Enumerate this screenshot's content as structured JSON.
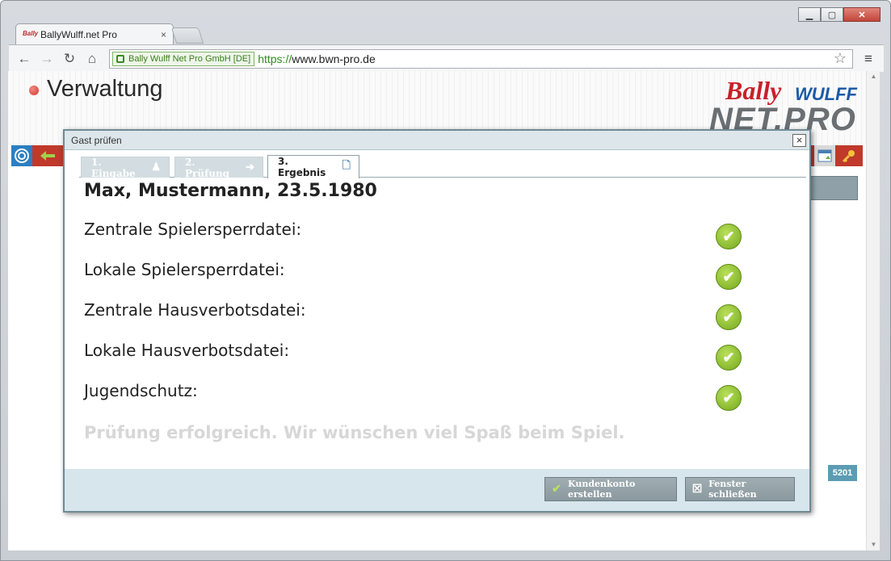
{
  "browser": {
    "tab_title": "BallyWulff.net Pro",
    "tab_close": "×",
    "ev_label": "Bally Wulff Net Pro GmbH [DE]",
    "url_scheme": "https://",
    "url_host": "www.bwn-pro.de",
    "favicon_text": "Bally",
    "controls": {
      "minimize": "▁",
      "maximize": "▢",
      "close": "✕"
    },
    "nav": {
      "back": "←",
      "forward": "→",
      "reload": "↻",
      "home": "⌂",
      "star": "☆",
      "menu": "≡"
    }
  },
  "page": {
    "title": "Verwaltung",
    "logo": {
      "bally": "Bally",
      "wulff": "WULFF",
      "netpro": "NET.PRO"
    },
    "badge": "5201"
  },
  "dialog": {
    "title": "Gast prüfen",
    "close_glyph": "×",
    "tabs": [
      {
        "label": "1. Eingabe",
        "icon": "person-icon",
        "glyph": "♟"
      },
      {
        "label": "2. Prüfung",
        "icon": "arrow-icon",
        "glyph": "➔"
      },
      {
        "label": "3. Ergebnis",
        "icon": "document-icon",
        "glyph": "🗋"
      }
    ],
    "guest_name": "Max, Mustermann, 23.5.1980",
    "checks": [
      {
        "label": "Zentrale Spielersperrdatei:",
        "status": "ok"
      },
      {
        "label": "Lokale Spielersperrdatei:",
        "status": "ok"
      },
      {
        "label": "Zentrale Hausverbotsdatei:",
        "status": "ok"
      },
      {
        "label": "Lokale Hausverbotsdatei:",
        "status": "ok"
      },
      {
        "label": "Jugendschutz:",
        "status": "ok"
      }
    ],
    "check_glyph": "✔",
    "success_message": "Prüfung erfolgreich. Wir wünschen viel Spaß beim Spiel.",
    "buttons": {
      "create_account": "Kundenkonto erstellen",
      "close_window": "Fenster schließen"
    },
    "button_glyphs": {
      "create": "✔",
      "close": "☒"
    }
  },
  "colors": {
    "toolbar_red": "#c0392b",
    "check_green": "#74a81e",
    "dialog_footer": "#d6e6ec",
    "ev_green": "#2f8c1c"
  }
}
